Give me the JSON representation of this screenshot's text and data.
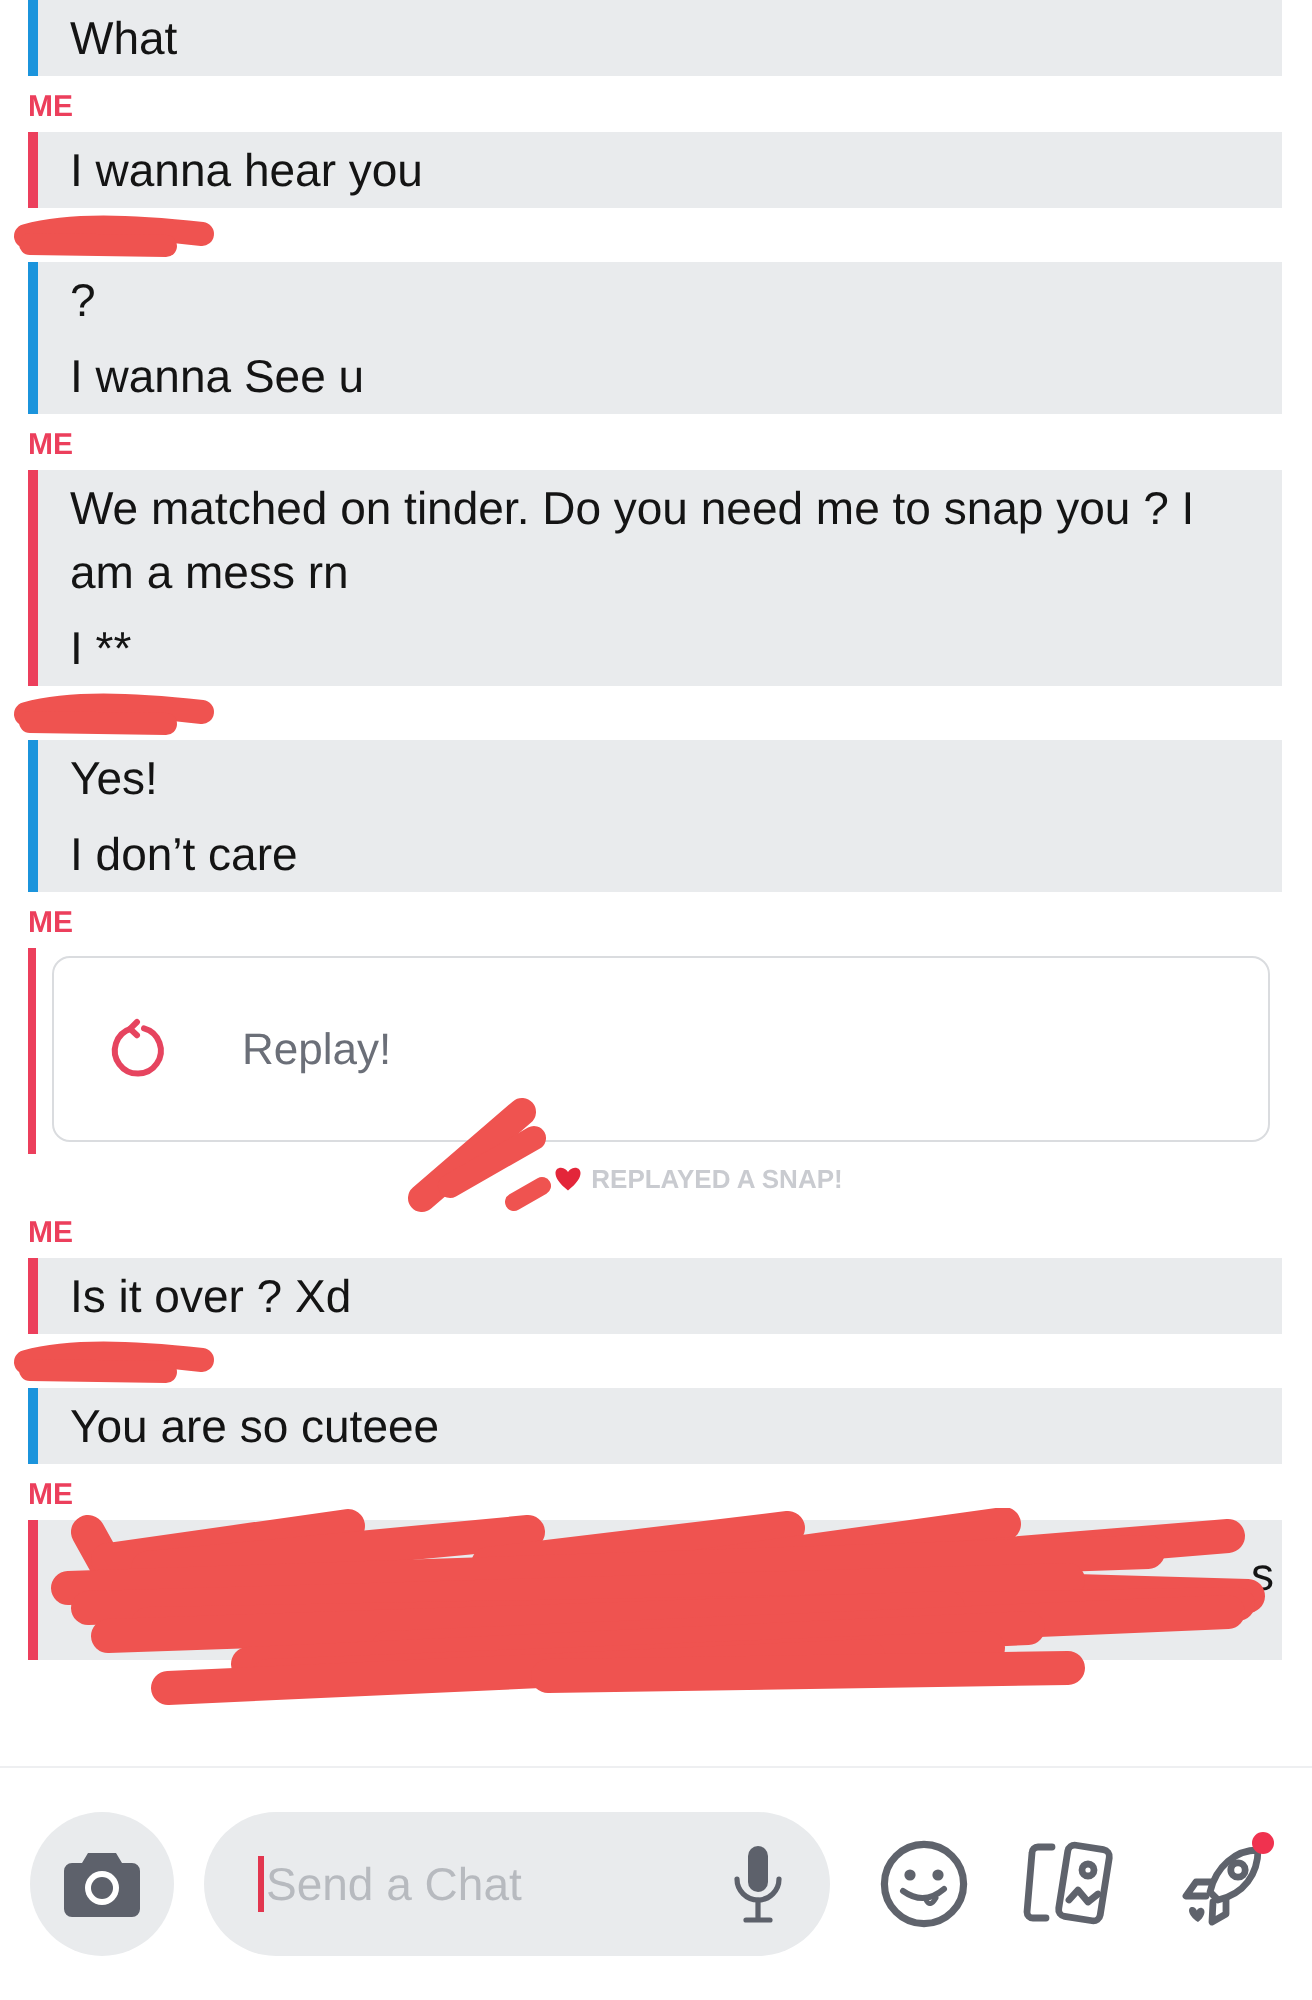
{
  "chat": [
    {
      "kind": "text",
      "color": "#1b94dc",
      "label_redacted": false,
      "messages": [
        "What"
      ]
    },
    {
      "kind": "text",
      "color": "#ec3f5c",
      "label": "ME",
      "label_redacted": false,
      "messages": [
        "I wanna hear you"
      ]
    },
    {
      "kind": "text",
      "color": "#1b94dc",
      "label_redacted": true,
      "messages": [
        "?",
        "I wanna See u"
      ]
    },
    {
      "kind": "text",
      "color": "#ec3f5c",
      "label": "ME",
      "label_redacted": false,
      "messages": [
        "We matched on tinder. Do you need me to snap you ? I am a mess rn",
        "I **"
      ]
    },
    {
      "kind": "text",
      "color": "#1b94dc",
      "label_redacted": true,
      "messages": [
        "Yes!",
        "I don’t care"
      ]
    },
    {
      "kind": "snap",
      "color": "#ec3f5c",
      "label": "ME",
      "label_redacted": false,
      "replay_label": "Replay!"
    },
    {
      "kind": "notice",
      "name_redacted": true,
      "text": "REPLAYED A SNAP!"
    },
    {
      "kind": "text",
      "color": "#ec3f5c",
      "label": "ME",
      "label_redacted": false,
      "messages": [
        "Is it over ? Xd"
      ]
    },
    {
      "kind": "text",
      "color": "#1b94dc",
      "label_redacted": true,
      "messages": [
        "You are so cuteee"
      ]
    },
    {
      "kind": "redacted",
      "color": "#ec3f5c",
      "label": "ME",
      "label_redacted": false,
      "visible_fragment": "s"
    }
  ],
  "composer": {
    "placeholder": "Send a Chat",
    "focused": true,
    "games_badge": true
  }
}
